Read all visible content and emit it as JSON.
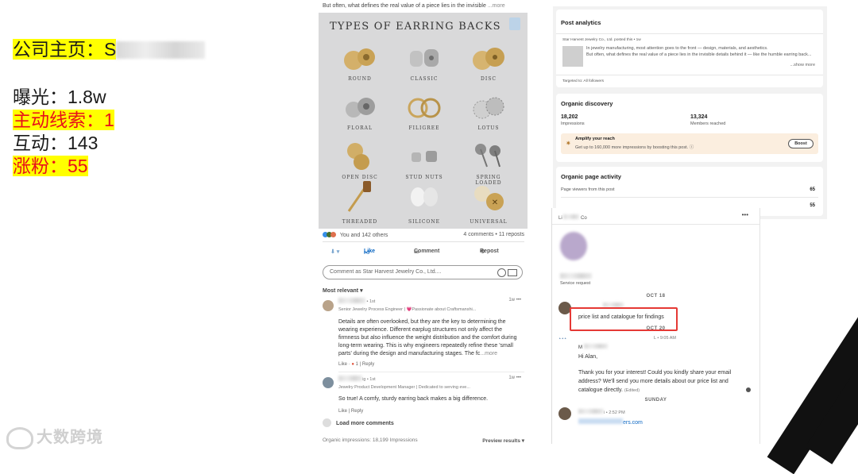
{
  "stats": {
    "homepage_label": "公司主页：S",
    "exposure": "曝光：1.8w",
    "active_leads": "主动线索：1",
    "interactions": "互动：143",
    "followers_gain": "涨粉：55"
  },
  "watermark": "大数跨境",
  "post": {
    "intro_text": "But often, what defines the real value of a piece lies in the invisible",
    "intro_more": "...more",
    "image_title": "TYPES OF EARRING BACKS",
    "earring_types": [
      "ROUND",
      "CLASSIC",
      "DISC",
      "FLORAL",
      "FILIGREE",
      "LOTUS",
      "OPEN DISC",
      "STUD NUTS",
      "SPRING LOADED",
      "THREADED",
      "SILICONE",
      "UNIVERSAL"
    ],
    "reactions": "You and 142 others",
    "comments_reposts": "4 comments • 11 reposts",
    "actions": {
      "like": "Like",
      "comment": "Comment",
      "repost": "Repost"
    },
    "comment_placeholder": "Comment as Star Harvest Jewelry Co., Ltd....",
    "sort_label": "Most relevant ▾",
    "comments": [
      {
        "degree": "• 1st",
        "headline": "Senior Jewelry Process Engineer | 💗Passionate about Craftsmanshi...",
        "time": "1w",
        "text": "Details are often overlooked, but they are the key to determining the wearing experience. Different earplug structures not only affect the firmness but also influence the weight distribution and the comfort during long-term wearing. This is why engineers repeatedly refine these 'small parts' during the design and manufacturing stages. The fc",
        "more": "...more",
        "like": "Like",
        "like_count": "1",
        "reply": "Reply"
      },
      {
        "name_suffix": "ig",
        "degree": "• 1st",
        "headline": "Jewelry Product Development Manager | Dedicated to serving eve...",
        "time": "1w",
        "text": "So true! A comfy, sturdy earring back makes a big difference.",
        "like": "Like",
        "reply": "Reply"
      }
    ],
    "load_more": "Load more comments",
    "organic_impressions": "Organic impressions: 18,199 Impressions",
    "preview_results": "Preview results ▾"
  },
  "analytics": {
    "post_analytics_title": "Post analytics",
    "poster_line": "Star Harvest Jewelry Co., Ltd. posted this • 1w",
    "post_excerpt_1": "In jewelry manufacturing, most attention goes to the front — design, materials, and aesthetics.",
    "post_excerpt_2": "But often, what defines the real value of a piece lies in the invisible details behind it — like the humble earring back...",
    "show_more": "...show more",
    "targeted": "Targeted to: All followers",
    "organic_discovery_title": "Organic discovery",
    "impressions_value": "18,202",
    "impressions_label": "Impressions",
    "members_value": "13,324",
    "members_label": "Members reached",
    "amplify_title": "Amplify your reach",
    "amplify_text": "Get up to 160,000 more impressions by boosting this post. ⓘ",
    "boost": "Boost",
    "page_activity_title": "Organic page activity",
    "page_viewers_label": "Page viewers from this post",
    "page_viewers_value": "65",
    "second_value": "55"
  },
  "messaging": {
    "header_left": "Li",
    "header_mid": "Co",
    "header_more": "•••",
    "service_request": "Service request",
    "date1": "OCT 18",
    "message1": "price list and catalogue for findings",
    "date2": "OCT 20",
    "sender2_time": "L • 9:05 AM",
    "sender2_initial": "M",
    "greeting": "Hi Alan,",
    "reply_text": "Thank you for your interest! Could you kindly share your email address? We'll send you more details about our price list and catalogue directly.",
    "edited": "(Edited)",
    "date3": "SUNDAY",
    "sender3_suffix": "i • 2:52 PM",
    "email_suffix": "ers.com"
  },
  "colors": {
    "highlight": "#ffff00",
    "red_text": "#e8101a",
    "link_blue": "#0a66c2",
    "box_red": "#e53935"
  }
}
